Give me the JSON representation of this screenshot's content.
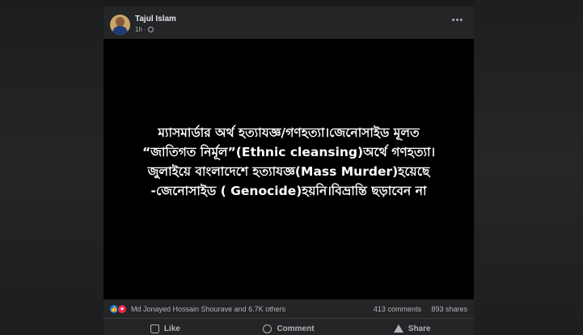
{
  "post": {
    "author": "Tajul Islam",
    "time": "1h",
    "privacy_icon": "globe-icon",
    "menu_icon": "more-icon",
    "image_text_lines": [
      "ম্যাসমার্ডার অর্থ হত্যাযজ্ঞ/গণহত্যা।জেনোসাইড মূলত",
      "“জাতিগত নির্মূল”(Ethnic cleansing)অর্থে গণহত্যা।",
      "জুলাইয়ে বাংলাদেশে হত্যাযজ্ঞ(Mass Murder)হয়েছে",
      "-জেনোসাইড ( Genocide)হয়নি।বিভ্রান্তি ছড়াবেন না"
    ],
    "reactors": "Md Jonayed Hossain Shourave and 6.7K others",
    "comments": "413 comments",
    "shares": "893 shares"
  },
  "actions": {
    "like": "Like",
    "comment": "Comment",
    "share": "Share"
  },
  "colors": {
    "card_bg": "#242526",
    "page_bg": "#18191a",
    "like_blue": "#1877f2",
    "love_red": "#f02849",
    "secondary_text": "#b0b3b8"
  }
}
